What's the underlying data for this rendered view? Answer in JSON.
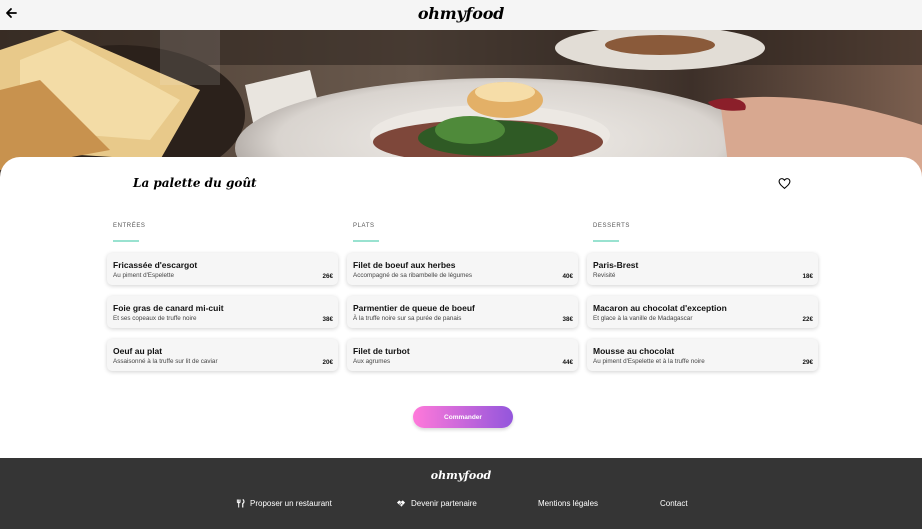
{
  "header": {
    "logo": "ohmyfood",
    "back_icon": "arrow-left-icon"
  },
  "restaurant": {
    "title": "La palette du goût",
    "favorite_icon": "heart-icon"
  },
  "menu": {
    "columns": [
      {
        "heading": "ENTRÉES",
        "items": [
          {
            "name": "Fricassée d'escargot",
            "desc": "Au piment d'Espelette",
            "price": "26€"
          },
          {
            "name": "Foie gras de canard mi-cuit",
            "desc": "Et ses copeaux de truffe noire",
            "price": "38€"
          },
          {
            "name": "Oeuf au plat",
            "desc": "Assaisonné à la truffe sur lit de caviar",
            "price": "20€"
          }
        ]
      },
      {
        "heading": "PLATS",
        "items": [
          {
            "name": "Filet de boeuf aux herbes",
            "desc": "Accompagné de sa ribambelle de légumes",
            "price": "40€"
          },
          {
            "name": "Parmentier de queue de boeuf",
            "desc": "À la truffe noire sur sa purée de panais",
            "price": "38€"
          },
          {
            "name": "Filet de turbot",
            "desc": "Aux agrumes",
            "price": "44€"
          }
        ]
      },
      {
        "heading": "DESSERTS",
        "items": [
          {
            "name": "Paris-Brest",
            "desc": "Revisité",
            "price": "18€"
          },
          {
            "name": "Macaron au chocolat d'exception",
            "desc": "Et glace à la vanille de Madagascar",
            "price": "22€"
          },
          {
            "name": "Mousse au chocolat",
            "desc": "Au piment d'Espelette et à la truffe noire",
            "price": "29€"
          }
        ]
      }
    ]
  },
  "order_button": "Commander",
  "footer": {
    "logo": "ohmyfood",
    "links": [
      {
        "label": "Proposer un restaurant",
        "icon": "utensils-icon"
      },
      {
        "label": "Devenir partenaire",
        "icon": "handshake-icon"
      },
      {
        "label": "Mentions légales",
        "icon": ""
      },
      {
        "label": "Contact",
        "icon": ""
      }
    ]
  },
  "colors": {
    "accent_underline": "#99e2d0",
    "button_gradient_start": "#ff79da",
    "button_gradient_end": "#9356dc",
    "footer_bg": "#353535",
    "header_bg": "#f5f5f5"
  }
}
